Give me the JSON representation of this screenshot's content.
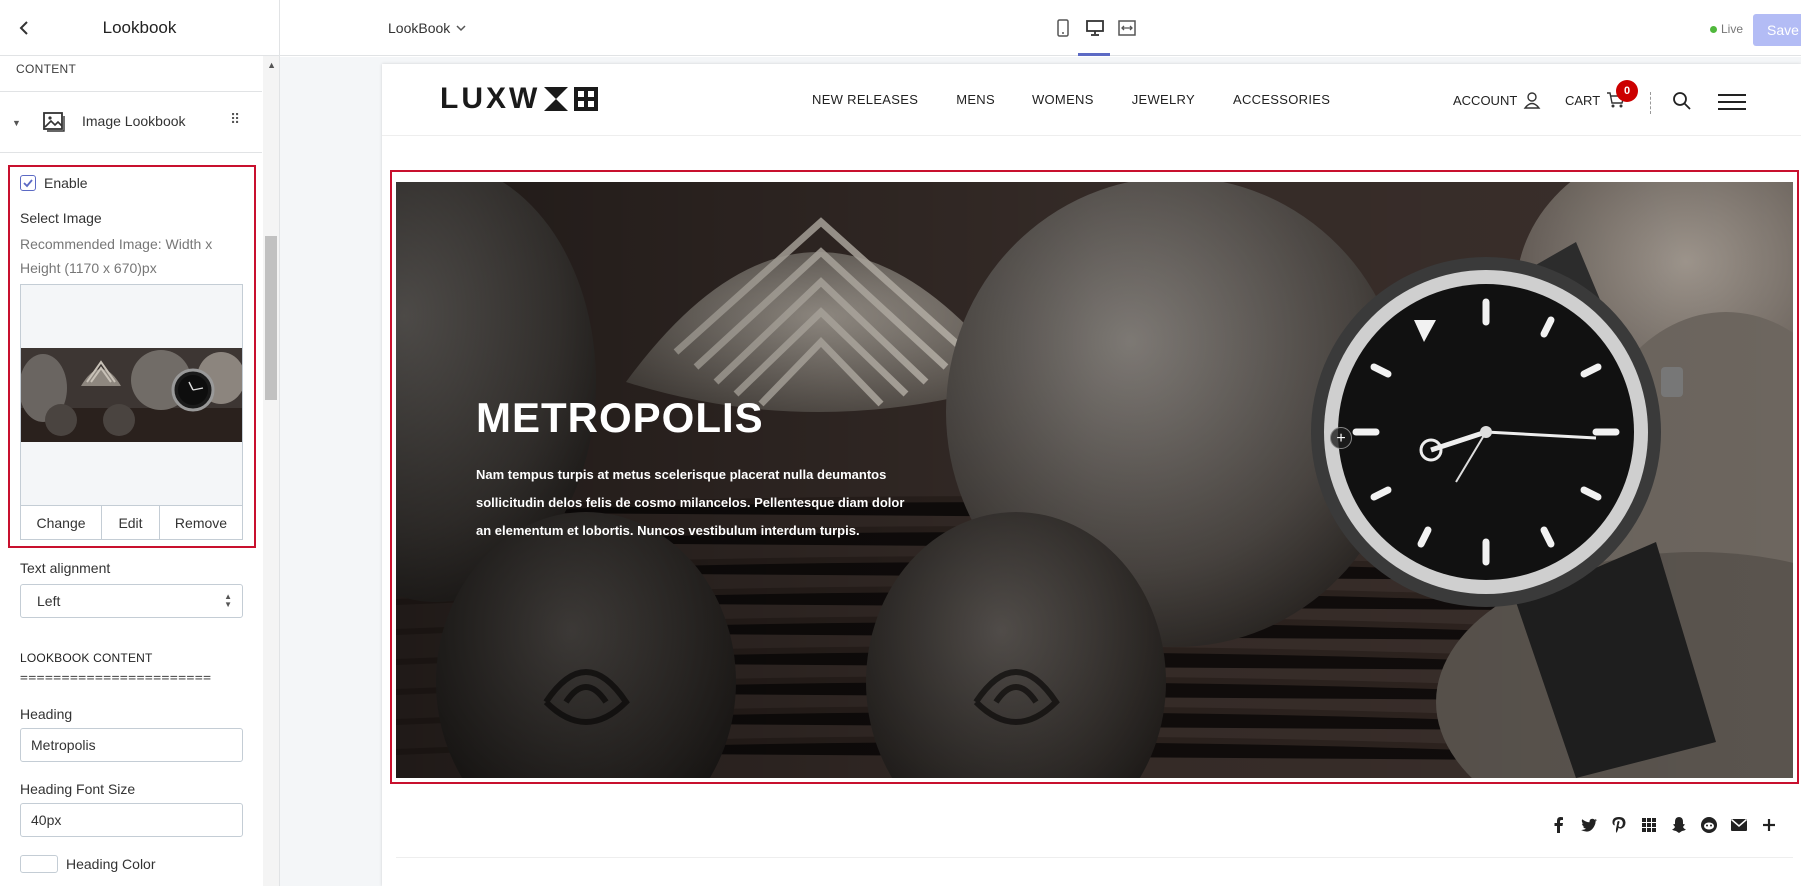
{
  "sidebar": {
    "title": "Lookbook",
    "section_label": "CONTENT",
    "block_label": "Image Lookbook",
    "enable_label": "Enable",
    "enable_checked": true,
    "select_image_label": "Select Image",
    "recommended_line1": "Recommended Image: Width x",
    "recommended_line2": "Height (1170 x 670)px",
    "image_buttons": {
      "change": "Change",
      "edit": "Edit",
      "remove": "Remove"
    },
    "text_alignment_label": "Text alignment",
    "text_alignment_value": "Left",
    "lookbook_content_label": "LOOKBOOK CONTENT",
    "rule_text": "=======================",
    "heading_label": "Heading",
    "heading_value": "Metropolis",
    "heading_font_size_label": "Heading Font Size",
    "heading_font_size_value": "40px",
    "heading_color_label": "Heading Color"
  },
  "topbar": {
    "template_name": "LookBook",
    "live_label": "Live",
    "save_label": "Save",
    "device_icons": [
      "mobile-icon",
      "desktop-icon",
      "fullwidth-icon"
    ],
    "active_device": "desktop"
  },
  "store": {
    "logo_text": "LUXW",
    "nav": [
      "NEW RELEASES",
      "MENS",
      "WOMENS",
      "JEWELRY",
      "ACCESSORIES"
    ],
    "account_label": "ACCOUNT",
    "cart_label": "CART",
    "cart_count": "0",
    "hero_title": "METROPOLIS",
    "hero_text": "Nam tempus turpis at metus scelerisque placerat nulla deumantos sollicitudin delos felis de cosmo milancelos. Pellentesque diam dolor an elementum et lobortis. Nuncos vestibulum interdum turpis.",
    "social_icons": [
      "facebook-icon",
      "twitter-icon",
      "pinterest-icon",
      "grid-icon",
      "snapchat-icon",
      "reddit-icon",
      "email-icon",
      "plus-icon"
    ]
  },
  "colors": {
    "accent": "#5c6ac4",
    "highlight_border": "#c8102e",
    "cart_badge": "#cc0000",
    "live_dot": "#50b83c",
    "save_button": "#b3bcf5"
  }
}
